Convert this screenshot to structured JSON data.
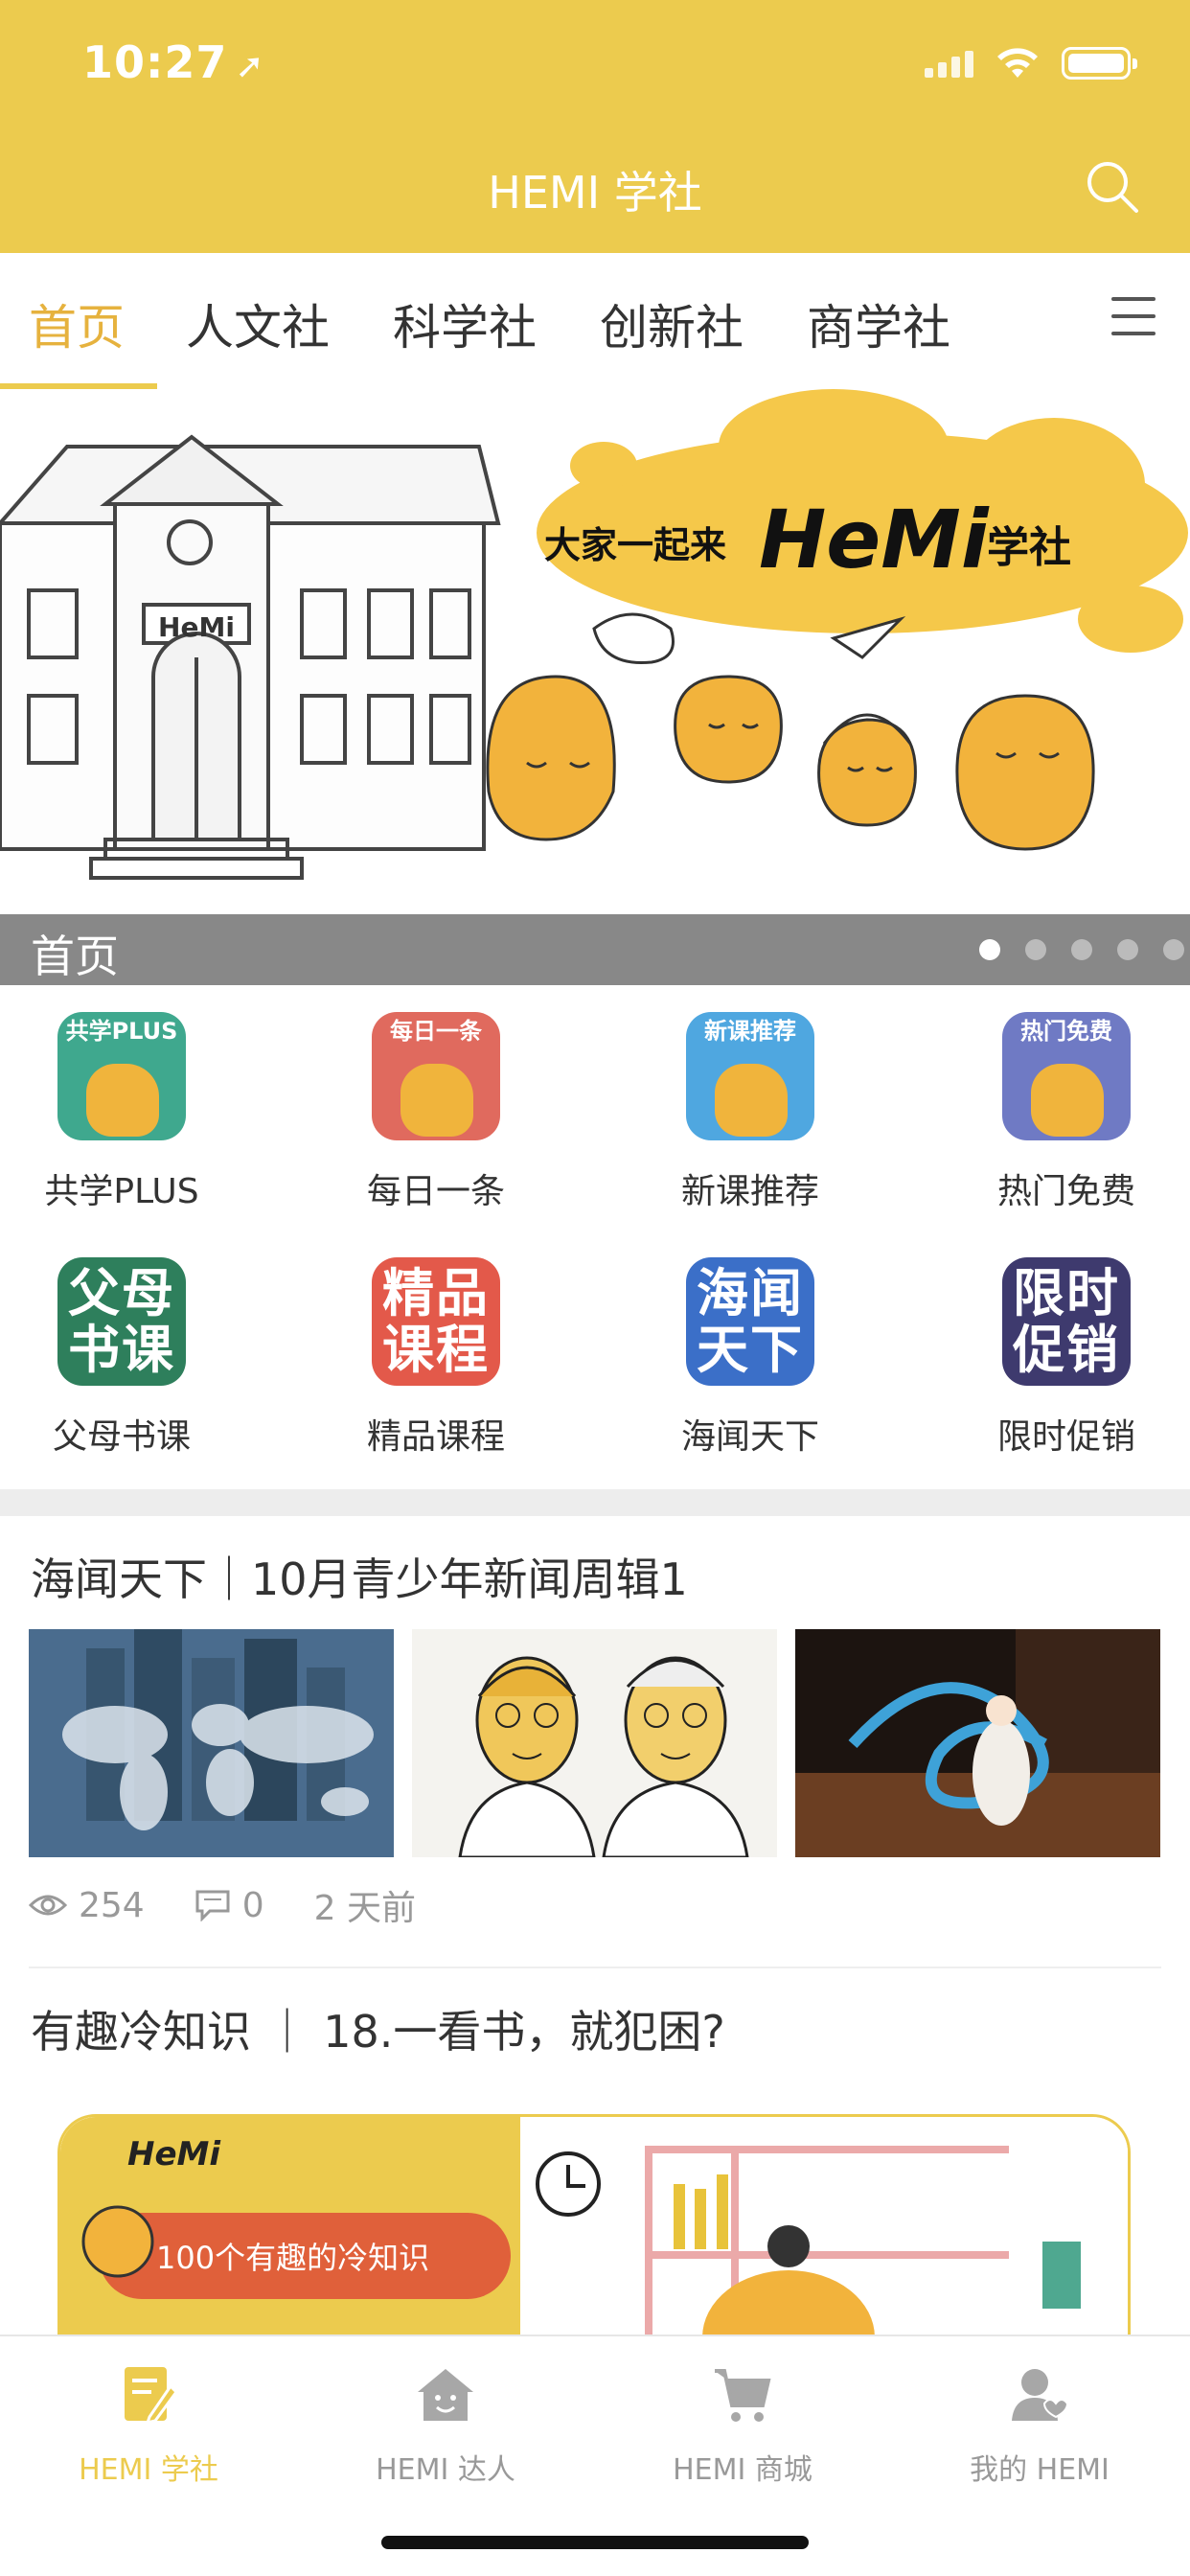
{
  "status": {
    "time": "10:27"
  },
  "header": {
    "title": "HEMI 学社"
  },
  "tabs": [
    {
      "label": "首页"
    },
    {
      "label": "人文社"
    },
    {
      "label": "科学社"
    },
    {
      "label": "创新社"
    },
    {
      "label": "商学社"
    }
  ],
  "banner": {
    "slogan_prefix": "大家一起来",
    "slogan_brand": "HeMi",
    "slogan_suffix": "学社",
    "building_sign": "HeMi",
    "caption": "首页",
    "slide_count": 5,
    "active_slide": 0
  },
  "grid": [
    {
      "label": "共学PLUS",
      "icon_text": "共学PLUS",
      "color": "#3FA88E"
    },
    {
      "label": "每日一条",
      "icon_text": "每日一条",
      "color": "#E06A5E"
    },
    {
      "label": "新课推荐",
      "icon_text": "新课推荐",
      "color": "#4FA7E0"
    },
    {
      "label": "热门免费",
      "icon_text": "热门免费",
      "color": "#6F7AC4"
    },
    {
      "label": "父母书课",
      "icon_text": "父母书课",
      "color": "#2E7F5C"
    },
    {
      "label": "精品课程",
      "icon_text": "精品课程",
      "color": "#E3594A"
    },
    {
      "label": "海闻天下",
      "icon_text": "海闻天下",
      "color": "#3B6FC8"
    },
    {
      "label": "限时促销",
      "icon_text": "限时促销",
      "color": "#3E3A6E"
    }
  ],
  "articles": [
    {
      "title": "海闻天下｜10月青少年新闻周辑1",
      "views": "254",
      "comments": "0",
      "time": "2 天前"
    },
    {
      "title": "有趣冷知识 ｜ 18.一看书，就犯困?",
      "card_tag": "100个有趣的冷知识",
      "card_brand": "HeMi"
    }
  ],
  "bottom_nav": [
    {
      "label": "HEMI 学社",
      "icon": "book-pen-icon",
      "active": true
    },
    {
      "label": "HEMI 达人",
      "icon": "house-face-icon",
      "active": false
    },
    {
      "label": "HEMI 商城",
      "icon": "cart-icon",
      "active": false
    },
    {
      "label": "我的 HEMI",
      "icon": "user-heart-icon",
      "active": false
    }
  ],
  "colors": {
    "brand": "#ECCB4E",
    "active_tab": "#E6B23E",
    "text": "#333333",
    "muted": "#999999"
  }
}
